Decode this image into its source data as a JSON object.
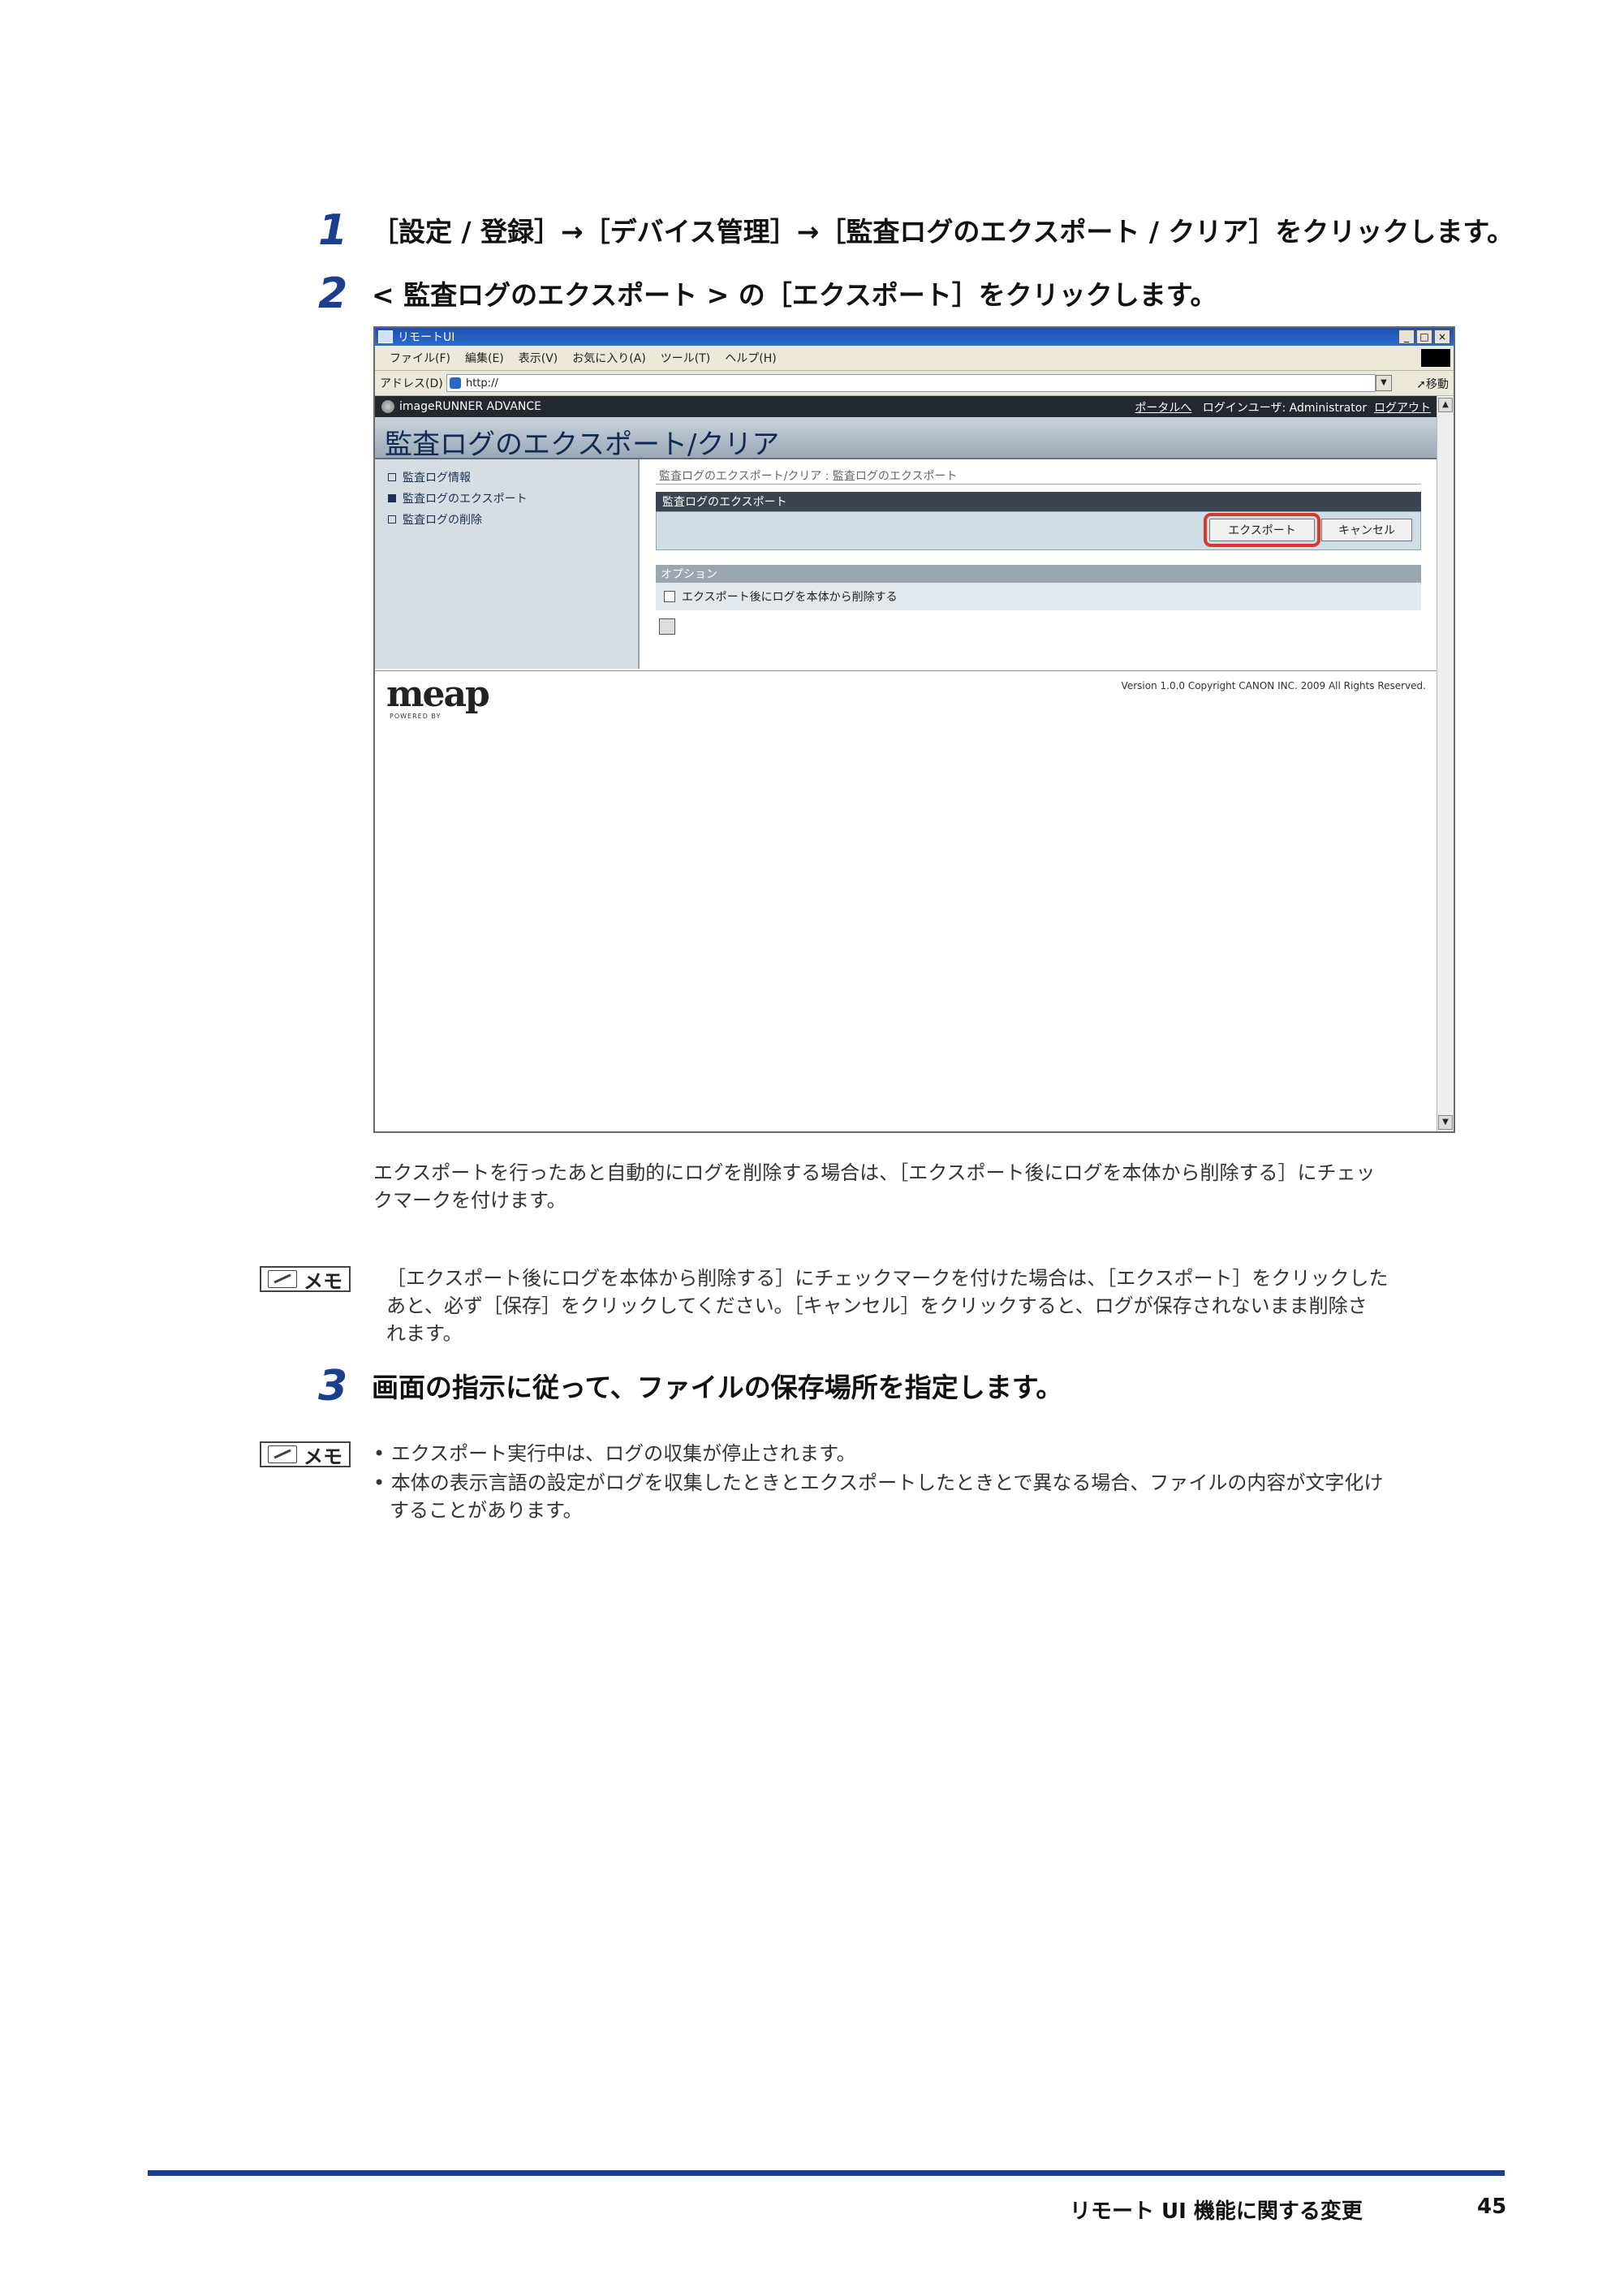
{
  "steps": [
    {
      "num": "1",
      "text": "［設定 / 登録］→［デバイス管理］→［監査ログのエクスポート / クリア］をクリックします。"
    },
    {
      "num": "2",
      "text": "< 監査ログのエクスポート > の［エクスポート］をクリックします。"
    },
    {
      "num": "3",
      "text": "画面の指示に従って、ファイルの保存場所を指定します。"
    }
  ],
  "window": {
    "title": "リモートUI",
    "controls": [
      "_",
      "□",
      "×"
    ],
    "menu": [
      "ファイル(F)",
      "編集(E)",
      "表示(V)",
      "お気に入り(A)",
      "ツール(T)",
      "ヘルプ(H)"
    ],
    "address_label": "アドレス(D)",
    "address_value": "http://",
    "go_label": "移動"
  },
  "app": {
    "brand": "imageRUNNER ADVANCE",
    "portal_link": "ポータルへ",
    "login_user": "ログインユーザ: Administrator",
    "logout": "ログアウト",
    "page_title": "監査ログのエクスポート/クリア",
    "nav": [
      "監査ログ情報",
      "監査ログのエクスポート",
      "監査ログの削除"
    ],
    "breadcrumb": "監査ログのエクスポート/クリア : 監査ログのエクスポート",
    "section_title": "監査ログのエクスポート",
    "export_button": "エクスポート",
    "cancel_button": "キャンセル",
    "options_title": "オプション",
    "option_checkbox": "エクスポート後にログを本体から削除する",
    "footer_logo": "meap",
    "footer_powered": "POWERED BY",
    "copyright": "Version 1.0.0 Copyright CANON INC. 2009 All Rights Reserved."
  },
  "paragraphs": {
    "after_shot_1": "エクスポートを行ったあと自動的にログを削除する場合は、［エクスポート後にログを本体から削除する］にチェッ",
    "after_shot_2": "クマークを付けます。",
    "memo1_1": "［エクスポート後にログを本体から削除する］にチェックマークを付けた場合は、［エクスポート］をクリックした",
    "memo1_2": "あと、必ず［保存］をクリックしてください。［キャンセル］をクリックすると、ログが保存されないまま削除さ",
    "memo1_3": "れます。",
    "memo2_b1": "• エクスポート実行中は、ログの収集が停止されます。",
    "memo2_b2_1": "• 本体の表示言語の設定がログを収集したときとエクスポートしたときとで異なる場合、ファイルの内容が文字化け",
    "memo2_b2_2": "することがあります。"
  },
  "memo_label": "メモ",
  "footer": {
    "title": "リモート UI 機能に関する変更",
    "page": "45"
  },
  "colors": {
    "accent": "#1a3f8f",
    "highlight": "#d9382c"
  }
}
